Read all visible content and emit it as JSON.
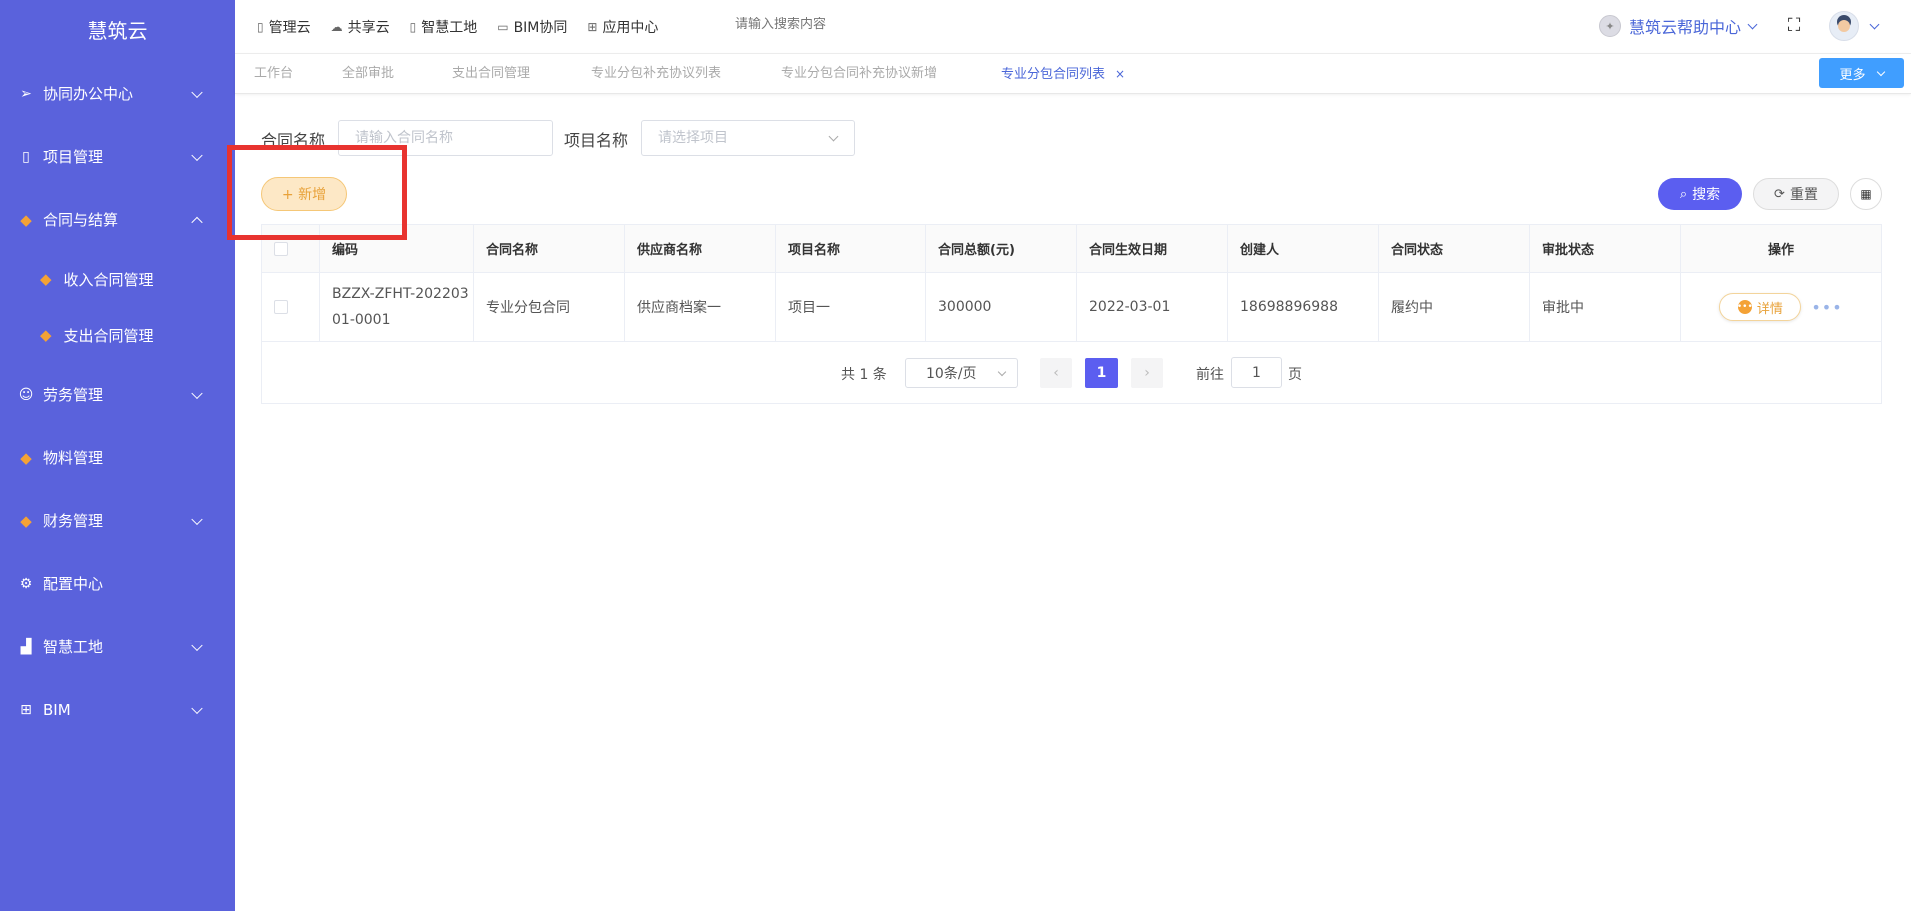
{
  "sidebar": {
    "brand": "慧筑云",
    "items": [
      {
        "label": "协同办公中心",
        "icon": "send-icon"
      },
      {
        "label": "项目管理",
        "icon": "book-icon"
      },
      {
        "label": "合同与结算",
        "icon": "gem-icon"
      },
      {
        "label": "收入合同管理",
        "icon": "gem-icon"
      },
      {
        "label": "支出合同管理",
        "icon": "gem-icon"
      },
      {
        "label": "劳务管理",
        "icon": "user-icon"
      },
      {
        "label": "物料管理",
        "icon": "gem-icon"
      },
      {
        "label": "财务管理",
        "icon": "gem-icon"
      },
      {
        "label": "配置中心",
        "icon": "gear-icon"
      },
      {
        "label": "智慧工地",
        "icon": "bar-chart-icon"
      },
      {
        "label": "BIM",
        "icon": "grid-icon"
      }
    ]
  },
  "header": {
    "nav": [
      {
        "label": "管理云"
      },
      {
        "label": "共享云"
      },
      {
        "label": "智慧工地"
      },
      {
        "label": "BIM协同"
      },
      {
        "label": "应用中心"
      }
    ],
    "search_placeholder": "请输入搜索内容",
    "help_label": "慧筑云帮助中心"
  },
  "tabs": {
    "items": [
      {
        "label": "工作台"
      },
      {
        "label": "全部审批"
      },
      {
        "label": "支出合同管理"
      },
      {
        "label": "专业分包补充协议列表"
      },
      {
        "label": "专业分包合同补充协议新增"
      },
      {
        "label": "专业分包合同列表"
      }
    ],
    "close_glyph": "×",
    "more_label": "更多"
  },
  "filter": {
    "contract_name_label": "合同名称",
    "contract_name_placeholder": "请输入合同名称",
    "project_name_label": "项目名称",
    "project_placeholder": "请选择项目"
  },
  "toolbar": {
    "add_label": "+ 新增",
    "search_label": "搜索",
    "reset_label": "重置"
  },
  "table": {
    "columns": [
      "编码",
      "合同名称",
      "供应商名称",
      "项目名称",
      "合同总额(元)",
      "合同生效日期",
      "创建人",
      "合同状态",
      "审批状态",
      "操作"
    ],
    "rows": [
      {
        "code_line1": "BZZX-ZFHT-202203",
        "code_line2": "01-0001",
        "contract_name": "专业分包合同",
        "supplier": "供应商档案一",
        "project": "项目一",
        "amount": "300000",
        "effective_date": "2022-03-01",
        "creator": "18698896988",
        "contract_status": "履约中",
        "approval_status": "审批中",
        "detail_label": "详情"
      }
    ]
  },
  "pagination": {
    "total_text": "共 1 条",
    "page_size": "10条/页",
    "current_page": "1",
    "goto_prefix": "前往",
    "goto_value": "1",
    "goto_suffix": "页"
  }
}
